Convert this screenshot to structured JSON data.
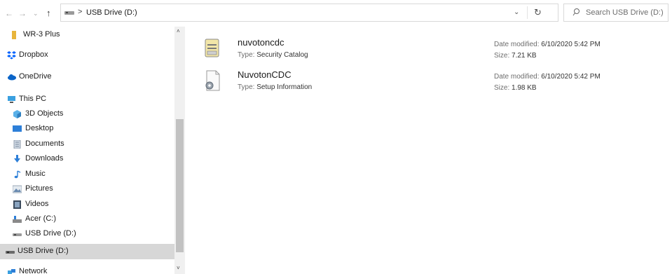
{
  "toolbar": {
    "back": "←",
    "forward": "→",
    "recent": "⌄",
    "up": "↑"
  },
  "address": {
    "separator": ">",
    "crumb": "USB Drive (D:)",
    "dropdown": "⌄",
    "refresh": "↻"
  },
  "search": {
    "placeholder": "Search USB Drive (D:)"
  },
  "nav": {
    "items": [
      {
        "label": "WR-3 Plus",
        "icon": "folder-icon"
      },
      {
        "label": "Dropbox",
        "icon": "dropbox-icon"
      },
      {
        "label": "OneDrive",
        "icon": "onedrive-icon"
      },
      {
        "label": "This PC",
        "icon": "this-pc-icon"
      },
      {
        "label": "3D Objects",
        "icon": "3d-objects-icon"
      },
      {
        "label": "Desktop",
        "icon": "desktop-icon"
      },
      {
        "label": "Documents",
        "icon": "documents-icon"
      },
      {
        "label": "Downloads",
        "icon": "downloads-icon"
      },
      {
        "label": "Music",
        "icon": "music-icon"
      },
      {
        "label": "Pictures",
        "icon": "pictures-icon"
      },
      {
        "label": "Videos",
        "icon": "videos-icon"
      },
      {
        "label": "Acer (C:)",
        "icon": "drive-icon"
      },
      {
        "label": "USB Drive (D:)",
        "icon": "usb-drive-icon"
      },
      {
        "label": "USB Drive (D:)",
        "icon": "usb-drive-icon",
        "selected": true
      },
      {
        "label": "Network",
        "icon": "network-icon"
      }
    ]
  },
  "scrollbar": {
    "up": "˄",
    "down": "˅"
  },
  "files": [
    {
      "name": "nuvotoncdc",
      "type_label": "Type:",
      "type": "Security Catalog",
      "date_label": "Date modified:",
      "date": "6/10/2020 5:42 PM",
      "size_label": "Size:",
      "size": "7.21 KB",
      "icon": "security-catalog-icon"
    },
    {
      "name": "NuvotonCDC",
      "type_label": "Type:",
      "type": "Setup Information",
      "date_label": "Date modified:",
      "date": "6/10/2020 5:42 PM",
      "size_label": "Size:",
      "size": "1.98 KB",
      "icon": "setup-information-icon"
    }
  ],
  "colors": {
    "selection": "#d7d7d7",
    "onedrive": "#0a64c8",
    "dropbox": "#0061fe",
    "folder": "#e8b53c"
  }
}
